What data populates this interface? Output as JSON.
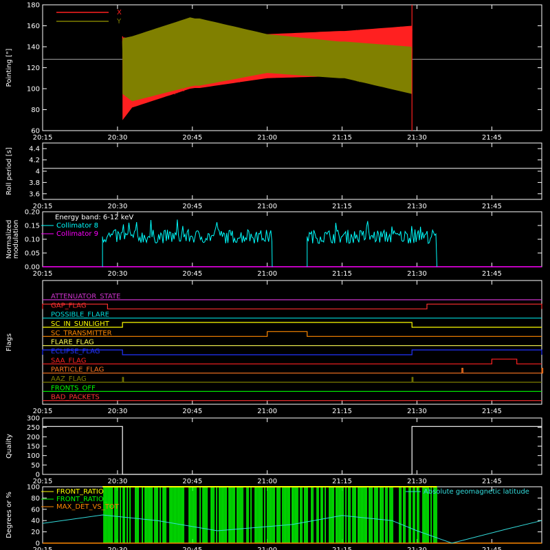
{
  "chart_data": [
    {
      "id": "pointing",
      "type": "line",
      "ylabel": "Pointing [\"]",
      "ylim": [
        60,
        180
      ],
      "yticks": [
        60,
        80,
        100,
        120,
        140,
        160,
        180
      ],
      "xticks": [
        "20:15",
        "20:30",
        "20:45",
        "21:00",
        "21:15",
        "21:30",
        "21:45"
      ],
      "reference_line": 128,
      "legend_placement": "top-left",
      "series": [
        {
          "name": "X",
          "color": "#ff2020",
          "band_x": [
            "20:31",
            "20:33",
            "20:45",
            "21:00",
            "21:15",
            "21:29"
          ],
          "upper": [
            150,
            140,
            150,
            152,
            155,
            160
          ],
          "lower": [
            70,
            82,
            100,
            110,
            112,
            113
          ]
        },
        {
          "name": "Y",
          "color": "#808000",
          "band_x": [
            "20:31",
            "20:33",
            "20:45",
            "21:00",
            "21:15",
            "21:29"
          ],
          "upper": [
            148,
            150,
            168,
            152,
            145,
            140
          ],
          "lower": [
            95,
            88,
            102,
            115,
            110,
            95
          ]
        }
      ]
    },
    {
      "id": "roll",
      "type": "line",
      "ylabel": "Roll period [s]",
      "ylim": [
        3.5,
        4.5
      ],
      "yticks": [
        3.6,
        3.8,
        4.0,
        4.2,
        4.4
      ],
      "xticks": [
        "20:15",
        "20:30",
        "20:45",
        "21:00",
        "21:15",
        "21:30",
        "21:45"
      ],
      "series": [
        {
          "name": "",
          "color": "#ffffff",
          "x": [
            "20:15",
            "21:55"
          ],
          "y": [
            4.05,
            4.05
          ]
        }
      ]
    },
    {
      "id": "modulation",
      "type": "line",
      "ylabel": "Normalized modulation",
      "ylim": [
        0,
        0.2
      ],
      "yticks": [
        "0.00",
        "0.05",
        "0.10",
        "0.15",
        "0.20"
      ],
      "xticks": [
        "20:15",
        "20:30",
        "20:45",
        "21:00",
        "21:15",
        "21:30",
        "21:45"
      ],
      "annotation": "Energy band: 6-12 keV",
      "legend_placement": "top-left",
      "series": [
        {
          "name": "Collimator 8",
          "color": "#00ffff",
          "segments": [
            [
              "20:27",
              "21:01"
            ],
            [
              "21:08",
              "21:34"
            ]
          ],
          "mean": 0.11
        },
        {
          "name": "Collimator 9",
          "color": "#ff00ff",
          "x": [
            "20:15",
            "21:55"
          ],
          "y": [
            0,
            0
          ]
        }
      ]
    },
    {
      "id": "flags",
      "type": "line",
      "ylabel": "Flags",
      "xticks": [
        "20:15",
        "20:30",
        "20:45",
        "21:00",
        "21:15",
        "21:30",
        "21:45"
      ],
      "series": [
        {
          "name": "ATTENUATOR_STATE",
          "color": "#cc33cc",
          "high": []
        },
        {
          "name": "SAA_FLAG_GAP",
          "label": "GAP_FLAG",
          "color": "#ff3030",
          "high": [
            [
              "20:15",
              "20:28"
            ],
            [
              "21:32",
              "21:55"
            ]
          ]
        },
        {
          "name": "POSSIBLE_FLARE",
          "color": "#00dddd",
          "high": []
        },
        {
          "name": "SC_IN_SUNLIGHT",
          "color": "#ffff00",
          "high": [
            [
              "20:31",
              "21:29"
            ]
          ]
        },
        {
          "name": "SC_TRANSMITTER",
          "color": "#ff8800",
          "high": [
            [
              "21:00",
              "21:08"
            ]
          ]
        },
        {
          "name": "FLARE_FLAG",
          "color": "#ffff55",
          "high": []
        },
        {
          "name": "ECLIPSE_FLAG",
          "color": "#2233ff",
          "high": [
            [
              "20:15",
              "20:31"
            ],
            [
              "21:29",
              "21:55"
            ]
          ]
        },
        {
          "name": "SAA_FLAG",
          "color": "#ff2222",
          "high": [
            [
              "21:45",
              "21:50"
            ]
          ]
        },
        {
          "name": "PARTICLE_FLAG",
          "color": "#ff7722",
          "high": [
            [
              "21:39",
              "21:39"
            ],
            [
              "21:55",
              "21:55"
            ]
          ]
        },
        {
          "name": "AAZ_FLAG",
          "color": "#808000",
          "high": [
            [
              "20:31",
              "20:31"
            ],
            [
              "21:29",
              "21:29"
            ]
          ]
        },
        {
          "name": "FRONTS_OFF",
          "color": "#00ff00",
          "high": []
        },
        {
          "name": "BAD_PACKETS",
          "color": "#ff3333",
          "high": []
        }
      ]
    },
    {
      "id": "quality",
      "type": "line",
      "ylabel": "Quality",
      "ylim": [
        0,
        300
      ],
      "yticks": [
        0,
        50,
        100,
        150,
        200,
        250,
        300
      ],
      "xticks": [
        "20:15",
        "20:30",
        "20:45",
        "21:00",
        "21:15",
        "21:30",
        "21:45"
      ],
      "series": [
        {
          "name": "",
          "color": "#ffffff",
          "x": [
            "20:15",
            "20:31",
            "20:31",
            "21:29",
            "21:29",
            "21:55"
          ],
          "y": [
            255,
            255,
            0,
            0,
            255,
            255
          ]
        }
      ]
    },
    {
      "id": "ratios",
      "type": "line",
      "ylabel": "Degrees or %",
      "ylim": [
        0,
        100
      ],
      "yticks": [
        0,
        20,
        40,
        60,
        80,
        100
      ],
      "xticks": [
        "20:15",
        "20:30",
        "20:45",
        "21:00",
        "21:15",
        "21:30",
        "21:45"
      ],
      "legend_placement": "top-left",
      "series": [
        {
          "name": "FRONT_RATIO",
          "color": "#ffff00",
          "x": [
            "20:27",
            "21:34"
          ],
          "y": [
            100,
            100
          ]
        },
        {
          "name": "FRONT_RATIO_",
          "color": "#00ff00",
          "segments": [
            [
              "20:27",
              "21:34"
            ]
          ]
        },
        {
          "name": "MAX_DET_VS_TOT",
          "color": "#ff8800",
          "x": [
            "20:15",
            "21:55"
          ],
          "y": [
            0,
            0
          ]
        },
        {
          "name": "Absolute geomagnetic latitude",
          "color": "#33dddd",
          "x": [
            "20:15",
            "20:27",
            "20:38",
            "20:50",
            "21:05",
            "21:15",
            "21:25",
            "21:30",
            "21:37",
            "21:48",
            "21:55"
          ],
          "y": [
            35,
            50,
            40,
            22,
            33,
            49,
            40,
            22,
            0,
            25,
            40
          ]
        }
      ]
    }
  ]
}
